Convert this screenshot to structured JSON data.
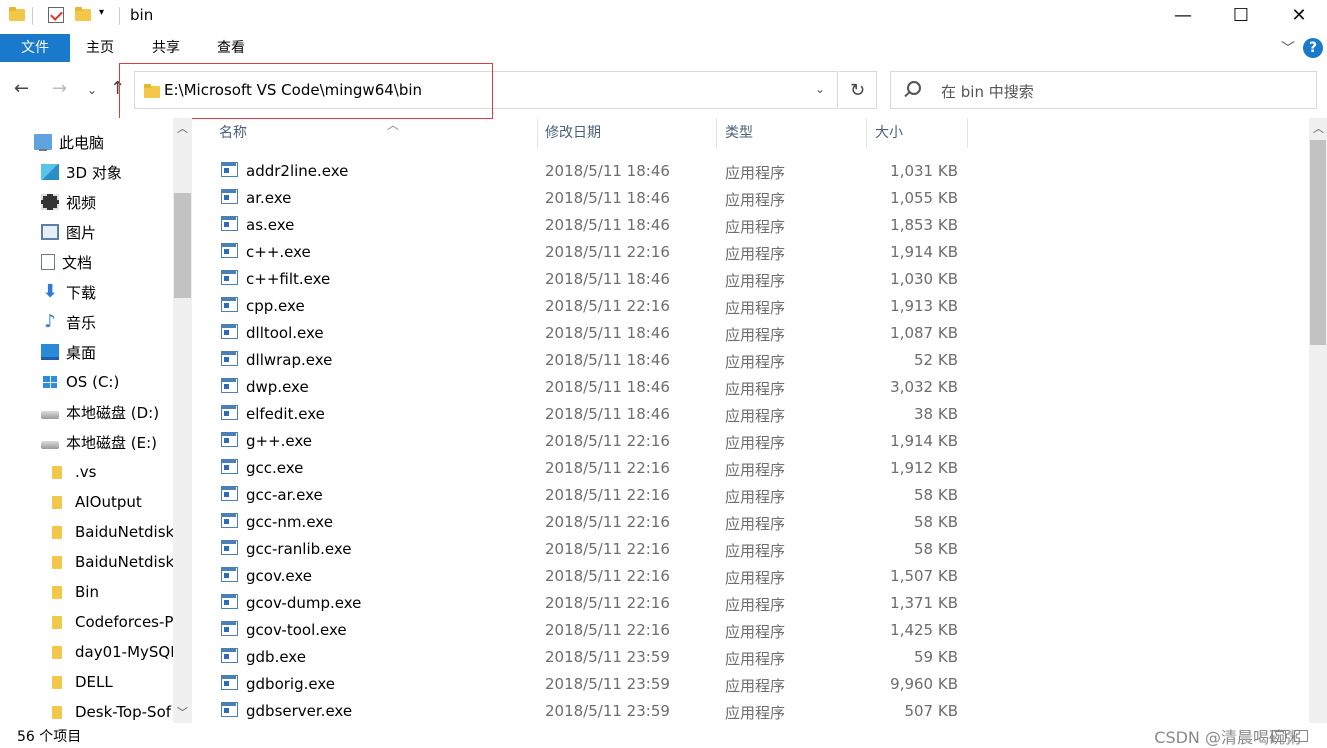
{
  "window": {
    "title": "bin",
    "controls": {
      "minimize": "—",
      "maximize": "☐",
      "close": "✕"
    }
  },
  "ribbon": {
    "tabs": [
      "文件",
      "主页",
      "共享",
      "查看"
    ],
    "help": "?"
  },
  "address": {
    "path": "E:\\Microsoft VS Code\\mingw64\\bin",
    "search_placeholder": "在 bin 中搜索"
  },
  "nav": {
    "items": [
      {
        "label": "此电脑",
        "icon": "computer-icon"
      },
      {
        "label": "3D 对象",
        "icon": "3d-objects-icon"
      },
      {
        "label": "视频",
        "icon": "video-icon"
      },
      {
        "label": "图片",
        "icon": "pictures-icon"
      },
      {
        "label": "文档",
        "icon": "documents-icon"
      },
      {
        "label": "下载",
        "icon": "download-icon"
      },
      {
        "label": "音乐",
        "icon": "music-icon"
      },
      {
        "label": "桌面",
        "icon": "desktop-icon"
      },
      {
        "label": "OS (C:)",
        "icon": "windows-drive-icon"
      },
      {
        "label": "本地磁盘 (D:)",
        "icon": "drive-icon"
      },
      {
        "label": "本地磁盘 (E:)",
        "icon": "drive-icon"
      },
      {
        "label": ".vs",
        "icon": "folder-icon"
      },
      {
        "label": "AIOutput",
        "icon": "folder-icon"
      },
      {
        "label": "BaiduNetdisk",
        "icon": "folder-icon"
      },
      {
        "label": "BaiduNetdisk",
        "icon": "folder-icon"
      },
      {
        "label": "Bin",
        "icon": "folder-icon"
      },
      {
        "label": "Codeforces-P",
        "icon": "folder-icon"
      },
      {
        "label": "day01-MySQL",
        "icon": "folder-icon"
      },
      {
        "label": "DELL",
        "icon": "folder-icon"
      },
      {
        "label": "Desk-Top-Sof",
        "icon": "folder-icon"
      }
    ]
  },
  "columns": {
    "name": "名称",
    "date": "修改日期",
    "type": "类型",
    "size": "大小"
  },
  "files": [
    {
      "name": "addr2line.exe",
      "date": "2018/5/11 18:46",
      "type": "应用程序",
      "size": "1,031 KB"
    },
    {
      "name": "ar.exe",
      "date": "2018/5/11 18:46",
      "type": "应用程序",
      "size": "1,055 KB"
    },
    {
      "name": "as.exe",
      "date": "2018/5/11 18:46",
      "type": "应用程序",
      "size": "1,853 KB"
    },
    {
      "name": "c++.exe",
      "date": "2018/5/11 22:16",
      "type": "应用程序",
      "size": "1,914 KB"
    },
    {
      "name": "c++filt.exe",
      "date": "2018/5/11 18:46",
      "type": "应用程序",
      "size": "1,030 KB"
    },
    {
      "name": "cpp.exe",
      "date": "2018/5/11 22:16",
      "type": "应用程序",
      "size": "1,913 KB"
    },
    {
      "name": "dlltool.exe",
      "date": "2018/5/11 18:46",
      "type": "应用程序",
      "size": "1,087 KB"
    },
    {
      "name": "dllwrap.exe",
      "date": "2018/5/11 18:46",
      "type": "应用程序",
      "size": "52 KB"
    },
    {
      "name": "dwp.exe",
      "date": "2018/5/11 18:46",
      "type": "应用程序",
      "size": "3,032 KB"
    },
    {
      "name": "elfedit.exe",
      "date": "2018/5/11 18:46",
      "type": "应用程序",
      "size": "38 KB"
    },
    {
      "name": "g++.exe",
      "date": "2018/5/11 22:16",
      "type": "应用程序",
      "size": "1,914 KB"
    },
    {
      "name": "gcc.exe",
      "date": "2018/5/11 22:16",
      "type": "应用程序",
      "size": "1,912 KB"
    },
    {
      "name": "gcc-ar.exe",
      "date": "2018/5/11 22:16",
      "type": "应用程序",
      "size": "58 KB"
    },
    {
      "name": "gcc-nm.exe",
      "date": "2018/5/11 22:16",
      "type": "应用程序",
      "size": "58 KB"
    },
    {
      "name": "gcc-ranlib.exe",
      "date": "2018/5/11 22:16",
      "type": "应用程序",
      "size": "58 KB"
    },
    {
      "name": "gcov.exe",
      "date": "2018/5/11 22:16",
      "type": "应用程序",
      "size": "1,507 KB"
    },
    {
      "name": "gcov-dump.exe",
      "date": "2018/5/11 22:16",
      "type": "应用程序",
      "size": "1,371 KB"
    },
    {
      "name": "gcov-tool.exe",
      "date": "2018/5/11 22:16",
      "type": "应用程序",
      "size": "1,425 KB"
    },
    {
      "name": "gdb.exe",
      "date": "2018/5/11 23:59",
      "type": "应用程序",
      "size": "59 KB"
    },
    {
      "name": "gdborig.exe",
      "date": "2018/5/11 23:59",
      "type": "应用程序",
      "size": "9,960 KB"
    },
    {
      "name": "gdbserver.exe",
      "date": "2018/5/11 23:59",
      "type": "应用程序",
      "size": "507 KB"
    }
  ],
  "status": {
    "count": "56 个项目",
    "watermark": "CSDN @清晨喝碗粥"
  },
  "colors": {
    "accent": "#1979ca",
    "highlight_box": "#e23a3a"
  }
}
